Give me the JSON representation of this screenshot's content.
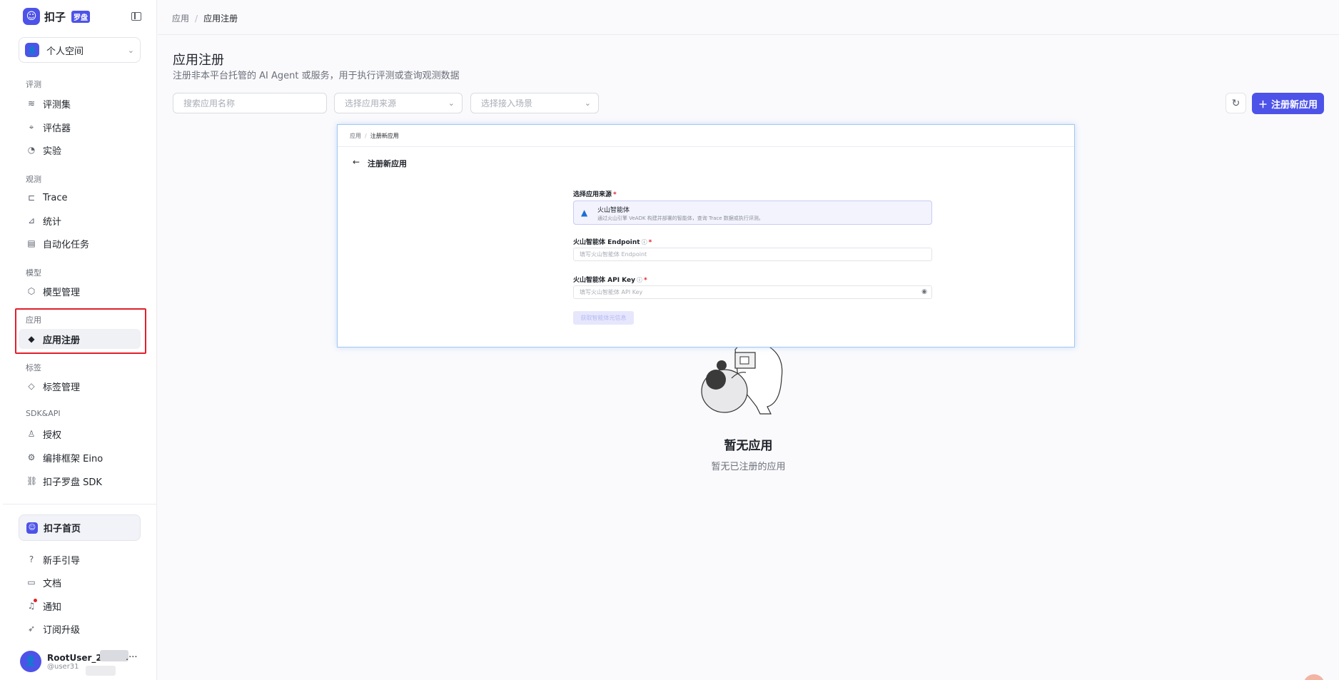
{
  "sidebar": {
    "brand": "扣子",
    "brand_badge": "罗盘",
    "workspace": "个人空间",
    "groups": {
      "eval": "评测",
      "observe": "观测",
      "model": "模型",
      "app": "应用",
      "tag": "标签",
      "sdk": "SDK&API"
    },
    "items": {
      "eval_set": "评测集",
      "evaluator": "评估器",
      "experiment": "实验",
      "trace": "Trace",
      "stats": "统计",
      "auto_task": "自动化任务",
      "model_manage": "模型管理",
      "app_register": "应用注册",
      "tag_manage": "标签管理",
      "auth": "授权",
      "eino": "编排框架 Eino",
      "sdk": "扣子罗盘 SDK"
    },
    "home": "扣子首页",
    "bottom": {
      "guide": "新手引导",
      "docs": "文档",
      "notify": "通知",
      "upgrade": "订阅升级"
    },
    "user": {
      "name": "RootUser_2",
      "handle": "@user31",
      "more": ".···"
    }
  },
  "breadcrumb": {
    "root": "应用",
    "current": "应用注册"
  },
  "page": {
    "title": "应用注册",
    "subtitle": "注册非本平台托管的 AI Agent 或服务，用于执行评测或查询观测数据"
  },
  "filters": {
    "search_placeholder": "搜索应用名称",
    "source_placeholder": "选择应用来源",
    "scene_placeholder": "选择接入场景"
  },
  "actions": {
    "register": "注册新应用"
  },
  "empty": {
    "title": "暂无应用",
    "desc": "暂无已注册的应用"
  },
  "inset": {
    "crumb_root": "应用",
    "crumb_current": "注册新应用",
    "title": "注册新应用",
    "source_label": "选择应用来源",
    "source_name": "火山智能体",
    "source_desc": "通过火山引擎 VeADK 构建并部署的智能体，查询 Trace 数据或执行评测。",
    "endpoint_label": "火山智能体 Endpoint",
    "endpoint_placeholder": "填写火山智能体 Endpoint",
    "apikey_label": "火山智能体 API Key",
    "apikey_placeholder": "填写火山智能体 API Key",
    "fetch_button": "获取智能体元信息",
    "required_mark": "*"
  },
  "colors": {
    "accent": "#4d53e8",
    "highlight": "#e0202b",
    "inset_border": "#9fc6f6"
  }
}
